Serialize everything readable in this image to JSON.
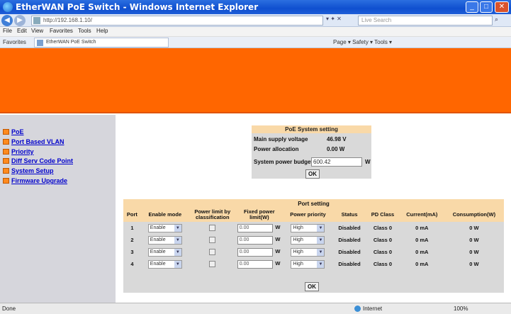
{
  "window": {
    "title": "EtherWAN PoE Switch - Windows Internet Explorer",
    "min_label": "_",
    "max_label": "□",
    "close_label": "✕"
  },
  "address_bar": {
    "url": "http://192.168.1.10/",
    "search_placeholder": "Live Search"
  },
  "menu": [
    "File",
    "Edit",
    "View",
    "Favorites",
    "Tools",
    "Help"
  ],
  "favorites": {
    "label": "Favorites",
    "tab_title": "EtherWAN PoE Switch",
    "tools_text": "Page ▾  Safety ▾  Tools ▾"
  },
  "sidebar": {
    "items": [
      {
        "label": "PoE"
      },
      {
        "label": "Port Based VLAN"
      },
      {
        "label": "Priority"
      },
      {
        "label": "Diff Serv Code Point"
      },
      {
        "label": "System Setup"
      },
      {
        "label": "Firmware Upgrade"
      }
    ]
  },
  "poe_system": {
    "title": "PoE System setting",
    "voltage_label": "Main supply voltage",
    "voltage_value": "46.98 V",
    "allocation_label": "Power allocation",
    "allocation_value": "0.00 W",
    "budget_label": "System power budget",
    "budget_value": "600.42",
    "budget_unit": "W",
    "ok_label": "OK"
  },
  "port_setting": {
    "title": "Port setting",
    "headers": [
      "Port",
      "Enable mode",
      "Power limit by classification",
      "Fixed power limit(W)",
      "Power priority",
      "Status",
      "PD Class",
      "Current(mA)",
      "Consumption(W)"
    ],
    "rows": [
      {
        "port": "1",
        "enable": "Enable",
        "fixed": "0.00",
        "unit": "W",
        "priority": "High",
        "status": "Disabled",
        "pd_class": "Class 0",
        "current": "0 mA",
        "consumption": "0 W"
      },
      {
        "port": "2",
        "enable": "Enable",
        "fixed": "0.00",
        "unit": "W",
        "priority": "High",
        "status": "Disabled",
        "pd_class": "Class 0",
        "current": "0 mA",
        "consumption": "0 W"
      },
      {
        "port": "3",
        "enable": "Enable",
        "fixed": "0.00",
        "unit": "W",
        "priority": "High",
        "status": "Disabled",
        "pd_class": "Class 0",
        "current": "0 mA",
        "consumption": "0 W"
      },
      {
        "port": "4",
        "enable": "Enable",
        "fixed": "0.00",
        "unit": "W",
        "priority": "High",
        "status": "Disabled",
        "pd_class": "Class 0",
        "current": "0 mA",
        "consumption": "0 W"
      }
    ],
    "ok_label": "OK"
  },
  "status_bar": {
    "status": "Done",
    "zone": "Internet",
    "zoom": "100%"
  },
  "colors": {
    "banner": "#ff6600",
    "header_bg": "#f9d9a8",
    "panel_bg": "#d9d9d9",
    "sidebar_bg": "#d6d6dc"
  }
}
